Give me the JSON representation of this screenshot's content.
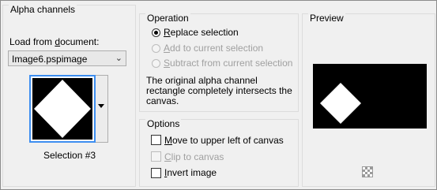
{
  "alpha": {
    "title": "Alpha channels",
    "load_label_pre": "Load from ",
    "load_label_key": "d",
    "load_label_post": "ocument:",
    "document": "Image6.pspimage",
    "selection_label": "Selection #3"
  },
  "operation": {
    "title": "Operation",
    "replace": {
      "key": "R",
      "rest": "eplace selection",
      "checked": true,
      "enabled": true
    },
    "add": {
      "key": "A",
      "rest": "dd to current selection",
      "checked": false,
      "enabled": false
    },
    "subtract": {
      "key": "S",
      "rest": "ubtract from current selection",
      "checked": false,
      "enabled": false
    },
    "info_line1": "The original alpha channel",
    "info_line2": "rectangle completely intersects the",
    "info_line3": "canvas."
  },
  "options": {
    "title": "Options",
    "move": {
      "key": "M",
      "rest": "ove to upper left of canvas",
      "checked": false,
      "enabled": true
    },
    "clip": {
      "key": "C",
      "rest": "lip to canvas",
      "checked": false,
      "enabled": false
    },
    "invert": {
      "key": "I",
      "rest": "nvert image",
      "checked": false,
      "enabled": true
    }
  },
  "preview": {
    "title": "Preview"
  },
  "icons": {
    "dropdown": "chevron-down-icon",
    "thumb_dropdown": "triangle-down-icon",
    "background": "checkerboard-icon"
  }
}
